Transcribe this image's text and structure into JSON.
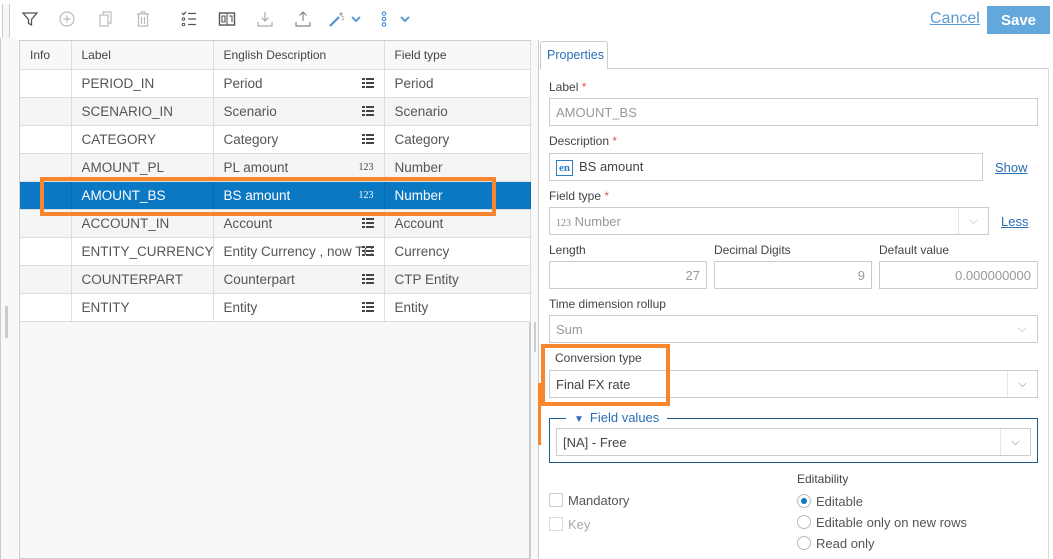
{
  "toolbar": {
    "icons": [
      "filter-icon",
      "add-icon",
      "copy-icon",
      "delete-icon",
      "checklist-icon",
      "layout-icon",
      "download-icon",
      "upload-icon",
      "magic-wand-icon",
      "more-options-icon"
    ],
    "cancel_label": "Cancel",
    "save_label": "Save"
  },
  "grid": {
    "columns": [
      "Info",
      "Label",
      "English Description",
      "Field type"
    ],
    "rows": [
      {
        "info": "",
        "label": "PERIOD_IN",
        "description": "Period",
        "icon": "list-icon",
        "field_type": "Period",
        "selected": false
      },
      {
        "info": "",
        "label": "SCENARIO_IN",
        "description": "Scenario",
        "icon": "list-icon",
        "field_type": "Scenario",
        "selected": false
      },
      {
        "info": "",
        "label": "CATEGORY",
        "description": "Category",
        "icon": "list-icon",
        "field_type": "Category",
        "selected": false
      },
      {
        "info": "",
        "label": "AMOUNT_PL",
        "description": "PL amount",
        "icon": "number-icon",
        "field_type": "Number",
        "selected": false
      },
      {
        "info": "",
        "label": "AMOUNT_BS",
        "description": "BS amount",
        "icon": "number-icon",
        "field_type": "Number",
        "selected": true
      },
      {
        "info": "",
        "label": "ACCOUNT_IN",
        "description": "Account",
        "icon": "list-icon",
        "field_type": "Account",
        "selected": false
      },
      {
        "info": "",
        "label": "ENTITY_CURRENCY_IN",
        "description": "Entity Currency , now TC",
        "icon": "list-icon",
        "field_type": "Currency",
        "selected": false
      },
      {
        "info": "",
        "label": "COUNTERPART",
        "description": "Counterpart",
        "icon": "list-icon",
        "field_type": "CTP Entity",
        "selected": false
      },
      {
        "info": "",
        "label": "ENTITY",
        "description": "Entity",
        "icon": "list-icon",
        "field_type": "Entity",
        "selected": false
      }
    ],
    "number_glyph": "123"
  },
  "properties": {
    "tab_label": "Properties",
    "label": {
      "title": "Label",
      "required": "*",
      "value": "AMOUNT_BS"
    },
    "description": {
      "title": "Description",
      "required": "*",
      "lang_badge": "en",
      "value": "BS amount",
      "show_link": "Show"
    },
    "field_type": {
      "title": "Field type",
      "required": "*",
      "glyph": "123",
      "value": "Number",
      "less_link": "Less"
    },
    "length": {
      "title": "Length",
      "value": "27"
    },
    "decimal_digits": {
      "title": "Decimal Digits",
      "value": "9"
    },
    "default_value": {
      "title": "Default value",
      "value": "0.000000000"
    },
    "time_rollup": {
      "title": "Time dimension rollup",
      "value": "Sum"
    },
    "conversion_type": {
      "title": "Conversion type",
      "value": "Final FX rate"
    },
    "field_values": {
      "legend": "Field values",
      "toggle": "▼",
      "value": "[NA] - Free"
    },
    "mandatory": {
      "label": "Mandatory",
      "checked": false
    },
    "key": {
      "label": "Key",
      "checked": false
    },
    "editability": {
      "title": "Editability",
      "options": [
        "Editable",
        "Editable only on new rows",
        "Read only"
      ],
      "selected": "Editable"
    }
  },
  "colors": {
    "selection": "#0a78c2",
    "highlight": "#f7862d",
    "save_button": "#62a8dc",
    "link": "#2a6fb5"
  }
}
